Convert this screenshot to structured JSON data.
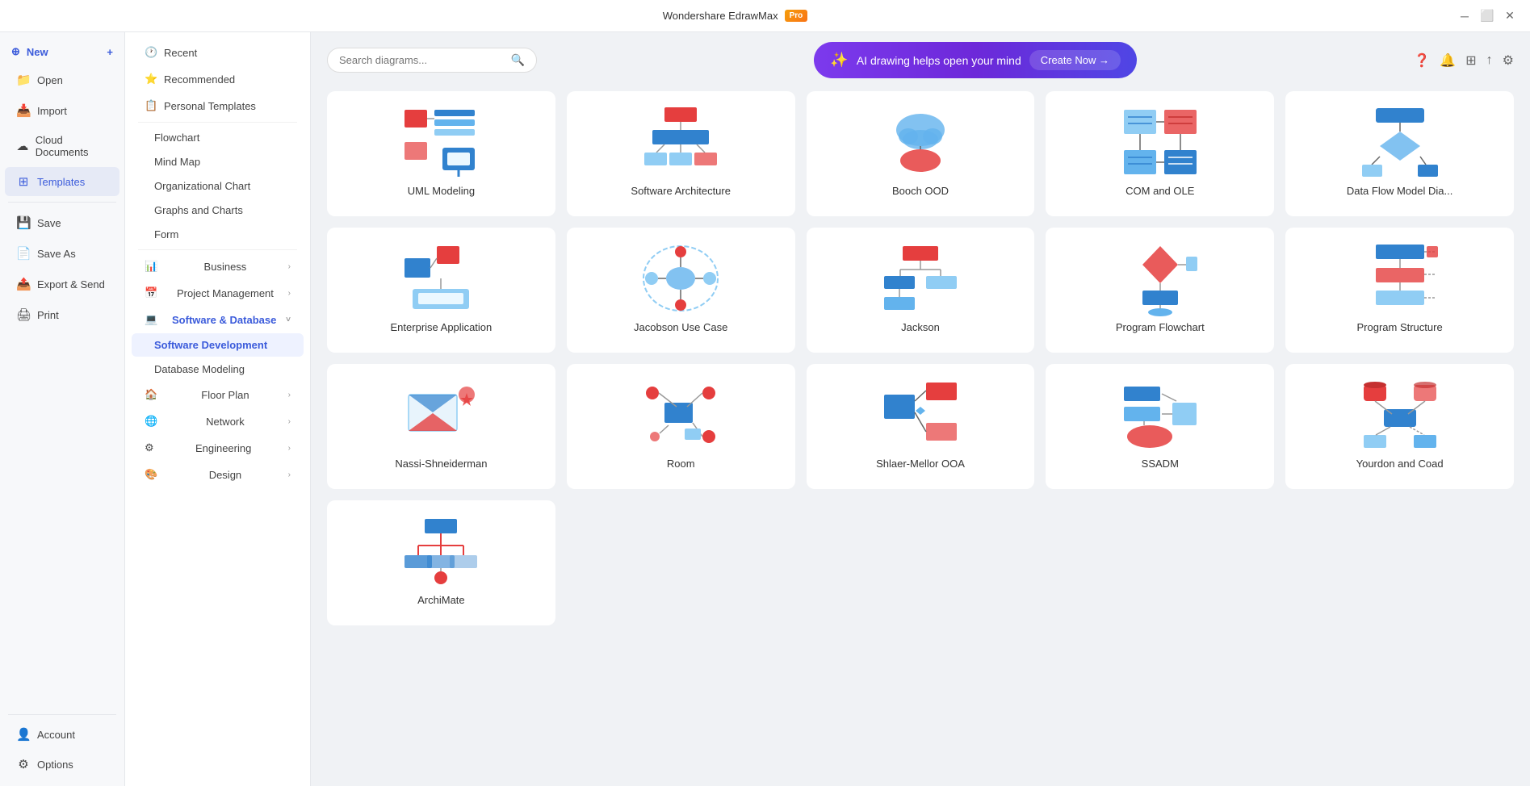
{
  "titlebar": {
    "app_name": "Wondershare EdrawMax",
    "pro_label": "Pro",
    "help_icon": "❓",
    "notif_icon": "🔔",
    "grid_icon": "⊞",
    "share_icon": "↑",
    "settings_icon": "⚙"
  },
  "sidebar": {
    "new_label": "New",
    "open_label": "Open",
    "import_label": "Import",
    "cloud_label": "Cloud Documents",
    "templates_label": "Templates",
    "save_label": "Save",
    "save_as_label": "Save As",
    "export_label": "Export & Send",
    "print_label": "Print",
    "account_label": "Account",
    "options_label": "Options"
  },
  "nav": {
    "recent_label": "Recent",
    "recommended_label": "Recommended",
    "personal_label": "Personal Templates",
    "flowchart_label": "Flowchart",
    "mind_map_label": "Mind Map",
    "org_chart_label": "Organizational Chart",
    "graphs_label": "Graphs and Charts",
    "form_label": "Form",
    "business_label": "Business",
    "project_label": "Project Management",
    "software_label": "Software & Database",
    "software_dev_label": "Software Development",
    "db_modeling_label": "Database Modeling",
    "floor_plan_label": "Floor Plan",
    "network_label": "Network",
    "engineering_label": "Engineering",
    "design_label": "Design"
  },
  "search": {
    "placeholder": "Search diagrams..."
  },
  "ai_banner": {
    "text": "AI drawing helps open your mind",
    "button": "Create Now →"
  },
  "templates": [
    {
      "id": "uml-modeling",
      "label": "UML Modeling",
      "color1": "#e53e3e",
      "color2": "#3182ce",
      "type": "uml"
    },
    {
      "id": "software-architecture",
      "label": "Software Architecture",
      "color1": "#e53e3e",
      "color2": "#3182ce",
      "type": "arch"
    },
    {
      "id": "booch-ood",
      "label": "Booch OOD",
      "color1": "#e53e3e",
      "color2": "#63b3ed",
      "type": "booch"
    },
    {
      "id": "com-ole",
      "label": "COM and OLE",
      "color1": "#e53e3e",
      "color2": "#3182ce",
      "type": "com"
    },
    {
      "id": "data-flow",
      "label": "Data Flow Model Dia...",
      "color1": "#3182ce",
      "color2": "#63b3ed",
      "type": "dataflow"
    },
    {
      "id": "enterprise-app",
      "label": "Enterprise Application",
      "color1": "#e53e3e",
      "color2": "#3182ce",
      "type": "enterprise"
    },
    {
      "id": "jacobson",
      "label": "Jacobson Use Case",
      "color1": "#e53e3e",
      "color2": "#63b3ed",
      "type": "jacobson"
    },
    {
      "id": "jackson",
      "label": "Jackson",
      "color1": "#e53e3e",
      "color2": "#3182ce",
      "type": "jackson"
    },
    {
      "id": "program-flowchart",
      "label": "Program Flowchart",
      "color1": "#e53e3e",
      "color2": "#3182ce",
      "type": "progflow"
    },
    {
      "id": "program-structure",
      "label": "Program Structure",
      "color1": "#e53e3e",
      "color2": "#3182ce",
      "type": "progstruct"
    },
    {
      "id": "nassi",
      "label": "Nassi-Shneiderman",
      "color1": "#e53e3e",
      "color2": "#3182ce",
      "type": "nassi"
    },
    {
      "id": "room",
      "label": "Room",
      "color1": "#e53e3e",
      "color2": "#3182ce",
      "type": "room"
    },
    {
      "id": "shlaer-mellor",
      "label": "Shlaer-Mellor OOA",
      "color1": "#e53e3e",
      "color2": "#3182ce",
      "type": "shlaer"
    },
    {
      "id": "ssadm",
      "label": "SSADM",
      "color1": "#e53e3e",
      "color2": "#3182ce",
      "type": "ssadm"
    },
    {
      "id": "yourdon",
      "label": "Yourdon and Coad",
      "color1": "#e53e3e",
      "color2": "#3182ce",
      "type": "yourdon"
    },
    {
      "id": "archimate",
      "label": "ArchiMate",
      "color1": "#e53e3e",
      "color2": "#3182ce",
      "type": "archimate"
    }
  ]
}
